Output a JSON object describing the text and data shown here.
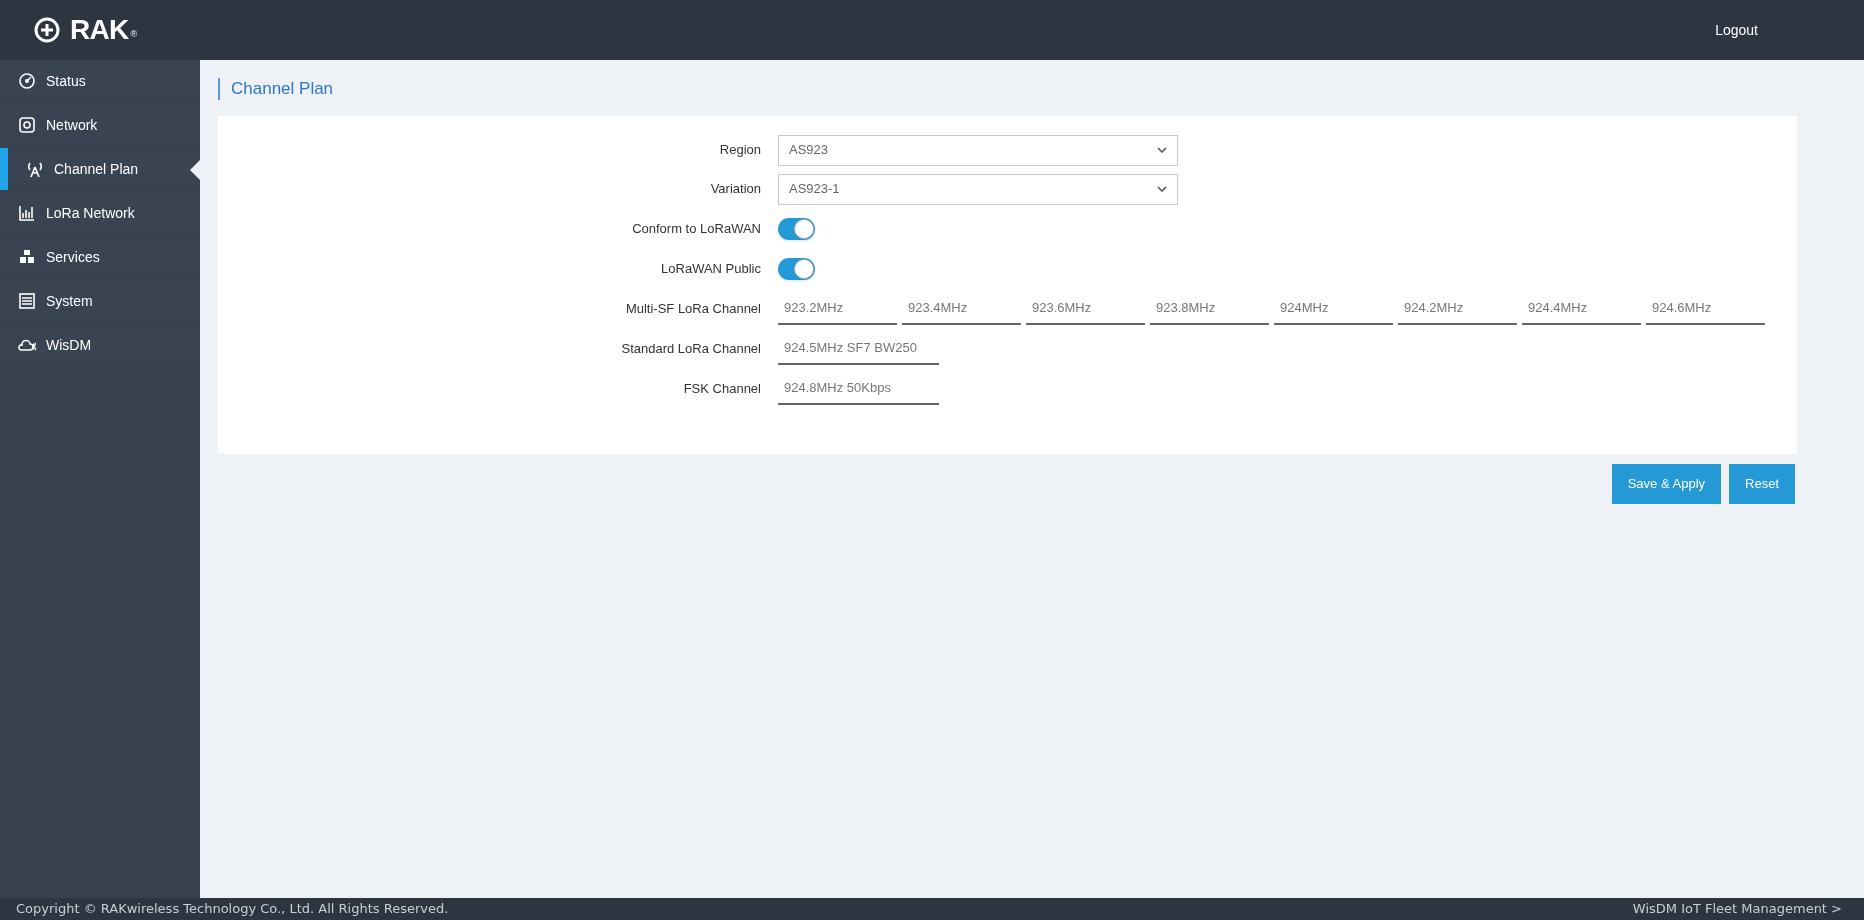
{
  "header": {
    "logo_text": "RAK",
    "logo_mark": "®",
    "logout": "Logout"
  },
  "sidebar": {
    "items": [
      {
        "label": "Status",
        "selected": false
      },
      {
        "label": "Network",
        "selected": false
      },
      {
        "label": "Channel Plan",
        "selected": true
      },
      {
        "label": "LoRa Network",
        "selected": false
      },
      {
        "label": "Services",
        "selected": false
      },
      {
        "label": "System",
        "selected": false
      },
      {
        "label": "WisDM",
        "selected": false
      }
    ]
  },
  "page_title": "Channel Plan",
  "form": {
    "rows": [
      {
        "kind": "select",
        "label": "Region",
        "value": "AS923"
      },
      {
        "kind": "select",
        "label": "Variation",
        "value": "AS923-1"
      },
      {
        "kind": "toggle",
        "label": "Conform to LoRaWAN",
        "on": true
      },
      {
        "kind": "toggle",
        "label": "LoRaWAN Public",
        "on": true
      },
      {
        "kind": "channels",
        "label": "Multi-SF LoRa Channel",
        "values": [
          "923.2MHz",
          "923.4MHz",
          "923.6MHz",
          "923.8MHz",
          "924MHz",
          "924.2MHz",
          "924.4MHz",
          "924.6MHz"
        ]
      },
      {
        "kind": "text",
        "label": "Standard LoRa Channel",
        "value": "924.5MHz SF7 BW250"
      },
      {
        "kind": "text",
        "label": "FSK Channel",
        "value": "924.8MHz 50Kbps"
      }
    ]
  },
  "buttons": [
    "Save & Apply",
    "Reset"
  ],
  "footer": {
    "copyright": "Copyright © RAKwireless Technology Co., Ltd. All Rights Reserved.",
    "link": "WisDM IoT Fleet Management >"
  }
}
